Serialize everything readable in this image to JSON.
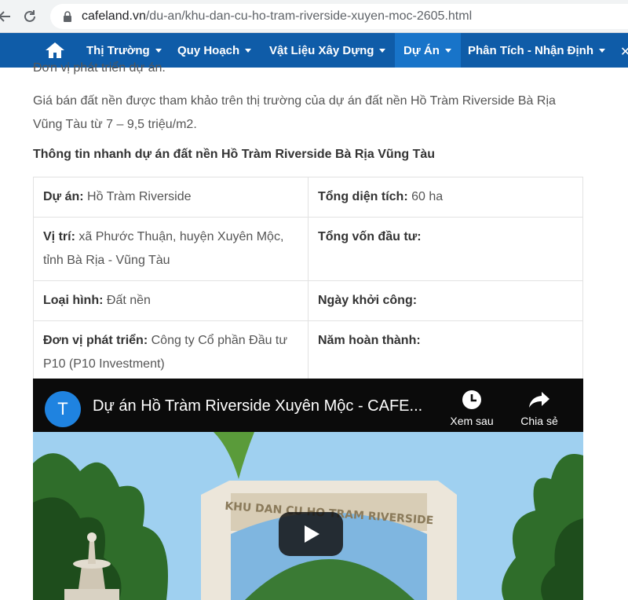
{
  "browser": {
    "url_host": "cafeland.vn",
    "url_path": "/du-an/khu-dan-cu-ho-tram-riverside-xuyen-moc-2605.html"
  },
  "nav": {
    "items": [
      {
        "label": "Thị Trường"
      },
      {
        "label": "Quy Hoạch"
      },
      {
        "label": "Vật Liệu Xây Dựng"
      },
      {
        "label": "Dự Án"
      },
      {
        "label": "Phân Tích - Nhận Định"
      }
    ],
    "active": "Dự Án"
  },
  "article": {
    "clipped_line": "Đơn vị phát triển dự án.",
    "paragraph": "Giá bán đất nền được tham khảo trên thị trường của dự án đất nền Hồ Tràm Riverside Bà Rịa Vũng Tàu từ 7 – 9,5 triệu/m2.",
    "heading": "Thông tin nhanh dự án đất nền Hồ Tràm Riverside Bà Rịa Vũng Tàu",
    "table": [
      [
        {
          "label": "Dự án:",
          "value": "Hồ Tràm Riverside"
        },
        {
          "label": "Tổng diện tích:",
          "value": "60 ha"
        }
      ],
      [
        {
          "label": "Vị trí:",
          "value": "xã Phước Thuận, huyện Xuyên Mộc, tỉnh Bà Rịa - Vũng Tàu"
        },
        {
          "label": "Tổng vốn đầu tư:",
          "value": ""
        }
      ],
      [
        {
          "label": "Loại hình:",
          "value": "Đất nền"
        },
        {
          "label": "Ngày khởi công:",
          "value": ""
        }
      ],
      [
        {
          "label": "Đơn vị phát triển:",
          "value": "Công ty Cổ phần Đầu tư P10 (P10 Investment)"
        },
        {
          "label": "Năm hoàn thành:",
          "value": ""
        }
      ]
    ]
  },
  "video": {
    "channel_initial": "T",
    "title": "Dự án Hồ Tràm Riverside Xuyên Mộc - CAFE...",
    "watch_later": "Xem sau",
    "share": "Chia sẻ",
    "gate_sign": "KHU DAN CU HO TRAM RIVERSIDE"
  }
}
